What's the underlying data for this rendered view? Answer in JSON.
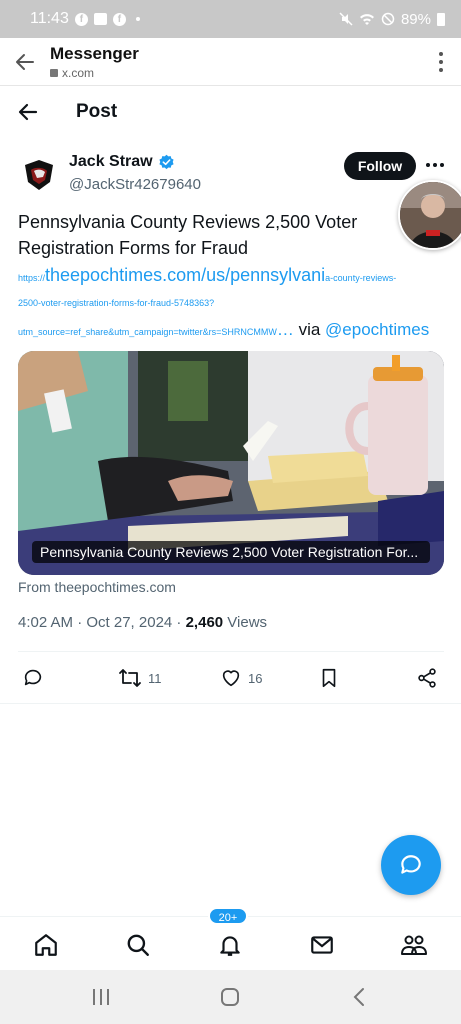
{
  "status_bar": {
    "time": "11:43",
    "battery": "89%"
  },
  "browser": {
    "app_title": "Messenger",
    "url": "x.com"
  },
  "post_header": {
    "title": "Post"
  },
  "author": {
    "name": "Jack Straw",
    "handle": "@JackStr42679640",
    "follow_label": "Follow"
  },
  "tweet": {
    "text": "Pennsylvania County Reviews 2,500 Voter Registration Forms for Fraud",
    "link_prefix": "https://",
    "link_main": "theepochtimes.com/us/pennsylvani",
    "link_rest1": "a-county-reviews-",
    "link_line2": "2500-voter-registration-forms-for-fraud-5748363?",
    "link_line3": "utm_source=ref_share&utm_campaign=twitter&rs=SHRNCMMW",
    "link_ellipsis": "…",
    "via": " via ",
    "mention": "@epochtimes"
  },
  "card": {
    "caption": "Pennsylvania County Reviews 2,500 Voter Registration For...",
    "from": "From theepochtimes.com"
  },
  "meta": {
    "time": "4:02 AM · Oct 27, 2024 · ",
    "views_count": "2,460",
    "views_label": " Views"
  },
  "actions": {
    "replies": "",
    "reposts": "11",
    "likes": "16"
  },
  "bottom_nav": {
    "notifications_badge": "20+"
  },
  "colors": {
    "accent": "#1d9bf0",
    "text": "#0f1419",
    "muted": "#536471"
  }
}
